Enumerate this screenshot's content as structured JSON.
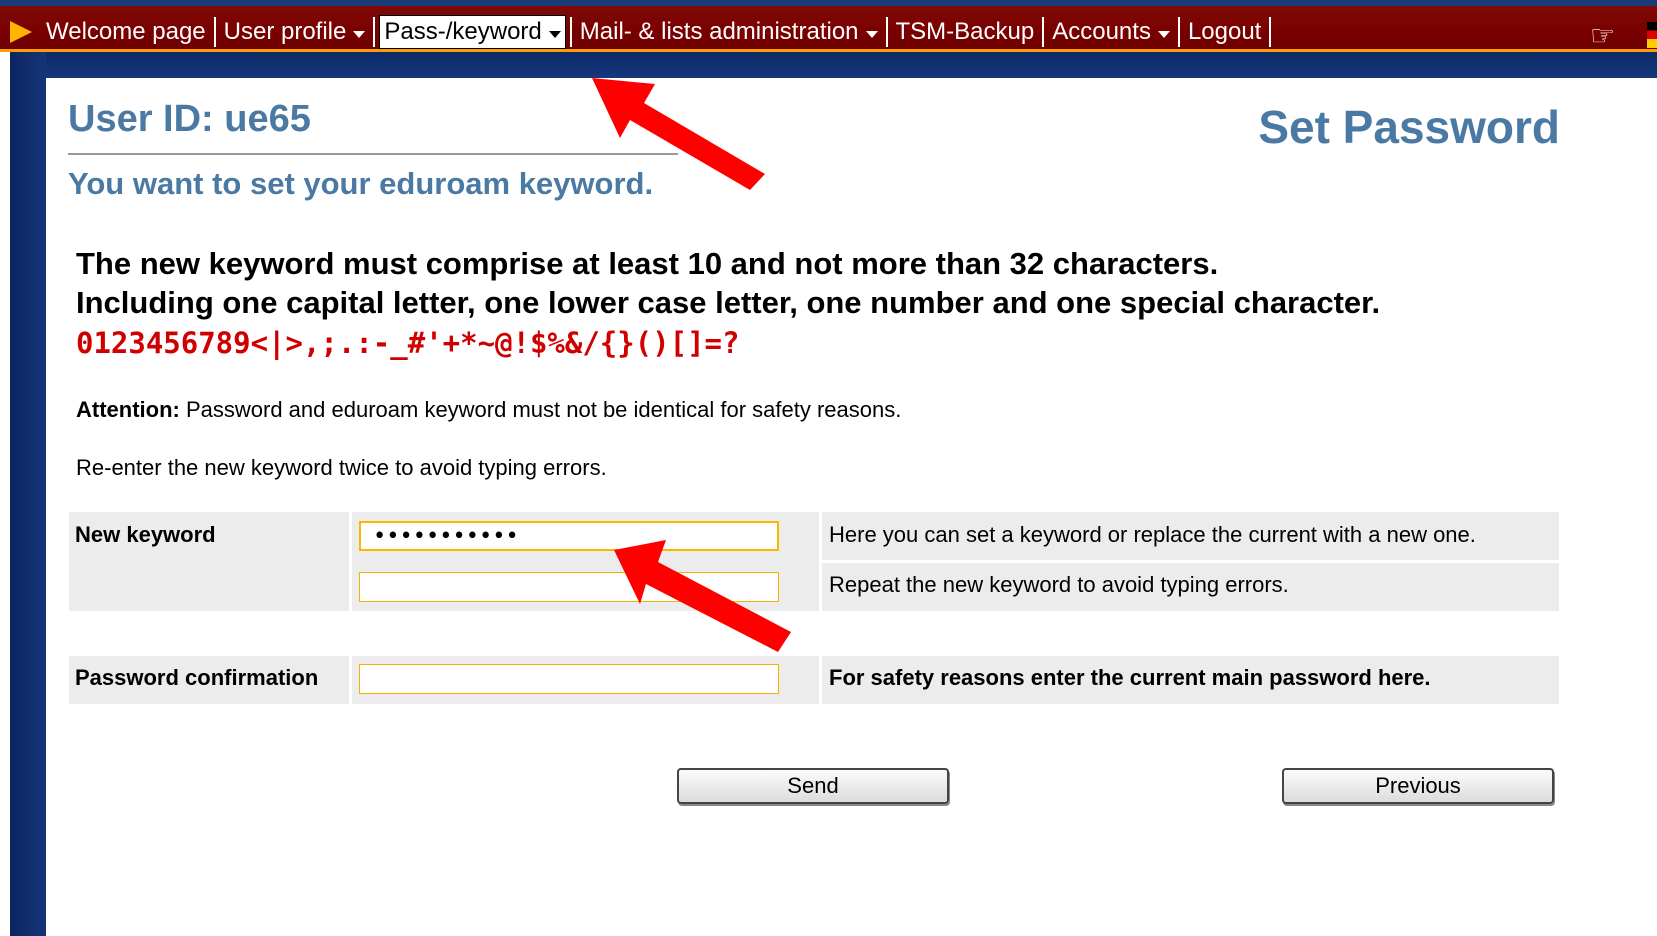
{
  "nav": {
    "items": [
      {
        "label": "Welcome page",
        "has_menu": false
      },
      {
        "label": "User profile",
        "has_menu": true
      },
      {
        "label": "Pass-/keyword",
        "has_menu": true,
        "active": true
      },
      {
        "label": "Mail- & lists administration",
        "has_menu": true
      },
      {
        "label": "TSM-Backup",
        "has_menu": false
      },
      {
        "label": "Accounts",
        "has_menu": true
      },
      {
        "label": "Logout",
        "has_menu": false
      }
    ],
    "accent_color": "#7a0000",
    "highlight_color": "#ff9d00"
  },
  "header": {
    "user_id": "User ID: ue65",
    "page_title": "Set Password",
    "subtitle": "You want to set your eduroam keyword."
  },
  "requirements": {
    "line1": "The new keyword must comprise at least 10 and not more than 32 characters.",
    "line2": "Including one capital letter, one lower case letter, one number and one special character.",
    "allowed_chars": "0123456789<|>,;.:-_#'+*~@!$%&/{}()[]=?"
  },
  "notes": {
    "attention_label": "Attention:",
    "attention_text": " Password and eduroam keyword must not be identical for safety reasons.",
    "reenter": "Re-enter the new keyword twice to avoid typing errors."
  },
  "form": {
    "new_keyword_label": "New keyword",
    "new_keyword_value": "•••••••••••",
    "new_keyword_hint": "Here you can set a keyword or replace the current with a new one.",
    "repeat_value": "",
    "repeat_hint": "Repeat the new keyword to avoid typing errors.",
    "password_label": "Password confirmation",
    "password_value": "",
    "password_hint": "For safety reasons enter the current main password here."
  },
  "buttons": {
    "send": "Send",
    "previous": "Previous"
  },
  "icons": {
    "nav_marker": "play-icon",
    "help": "pointing-hand-icon",
    "language": "flag-icon"
  }
}
